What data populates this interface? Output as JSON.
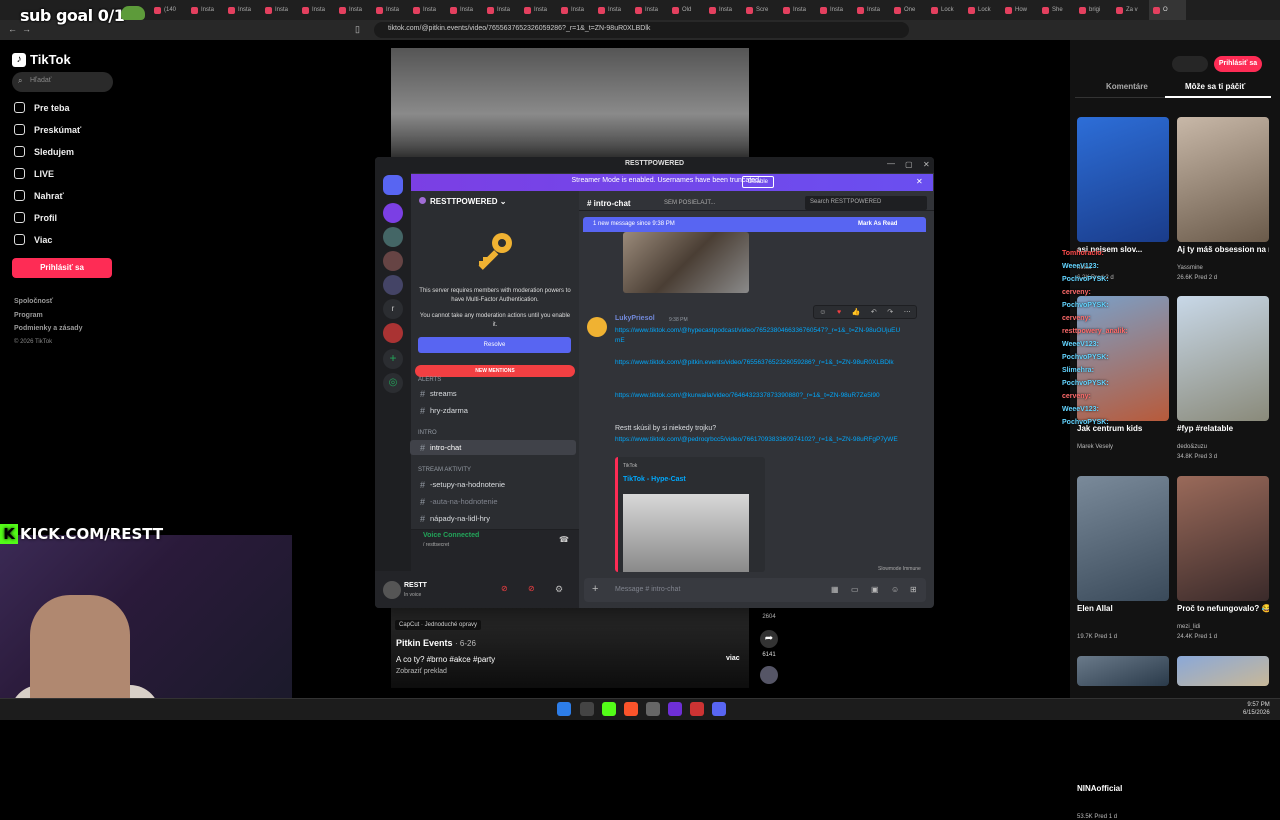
{
  "overlay": {
    "subgoal": "sub goal 0/1",
    "kick": "KICK.COM/RESTT"
  },
  "browser": {
    "tabs": [
      "(140",
      "Insta",
      "Insta",
      "Insta",
      "Insta",
      "Insta",
      "Insta",
      "Insta",
      "Insta",
      "Insta",
      "Insta",
      "Insta",
      "Insta",
      "Insta",
      "Old",
      "Insta",
      "Scre",
      "Insta",
      "Insta",
      "Insta",
      "One",
      "Lock",
      "Lock",
      "How",
      "She",
      "brigi",
      "Za v",
      "O"
    ],
    "url": "tiktok.com/@pitkin.events/video/7655637652326059286?_r=1&_t=ZN-98uR0XLBDlk"
  },
  "tiktok": {
    "logo": "TikTok",
    "search_placeholder": "Hľadať",
    "nav": [
      "Pre teba",
      "Preskúmať",
      "Sledujem",
      "LIVE",
      "Nahrať",
      "Profil",
      "Viac"
    ],
    "login": "Prihlásiť sa",
    "footer": [
      "Spoločnosť",
      "Program",
      "Podmienky a zásady"
    ],
    "copyright": "© 2026 TikTok",
    "video": {
      "capcut": "CapCut · Jednoduché opravy",
      "author": "Pitkin Events",
      "date": "· 6-26",
      "caption": "A co ty? #brno #akce #party",
      "translate": "Zobraziť preklad",
      "more": "viac",
      "likes": "2604",
      "shares": "6141"
    },
    "right": {
      "login": "Prihlásiť sa",
      "tabs": [
        "Komentáre",
        "Môže sa ti páčiť"
      ],
      "videos": [
        {
          "title": "asi nejsem slov...",
          "author": "helca",
          "views": "6.2K",
          "age": "Pred 2 d"
        },
        {
          "title": "Aj ty máš obsession na ružovú? 💖 Tak...",
          "author": "Yassmine",
          "views": "26.6K",
          "age": "Pred 2 d"
        },
        {
          "title": "Jak centrum kids",
          "author": "Marek Vesely",
          "views": "",
          "age": ""
        },
        {
          "title": "#fyp #relatable",
          "author": "dedo&zuzu",
          "views": "34.8K",
          "age": "Pred 3 d"
        },
        {
          "title": "Elen Allal",
          "author": "",
          "views": "19.7K",
          "age": "Pred 1 d"
        },
        {
          "title": "Proč to nefungovalo? 😂 #fyp...",
          "author": "mezi_lidi",
          "views": "24.4K",
          "age": "Pred 1 d"
        },
        {
          "title": "NINAofficial",
          "author": "",
          "views": "53.5K",
          "age": "Pred 1 d"
        }
      ]
    }
  },
  "chat": [
    "Tomhoracio:",
    "WeeeV123:",
    "PochvoPYSK:",
    "cerveny:",
    "PochvoPYSK:",
    "cerveny:",
    "resttpowery_analik:",
    "WeeeV123:",
    "PochvoPYSK:",
    "Slimehra:",
    "PochvoPYSK:",
    "cerveny:",
    "WeeeV123:",
    "PochvoPYSK:"
  ],
  "discord": {
    "title": "RESTTPOWERED",
    "streamer_mode": "Streamer Mode is enabled. Usernames have been truncated.",
    "disable": "Disable",
    "server": "RESTTPOWERED",
    "mfa1": "This server requires members with moderation powers to have Multi-Factor Authentication.",
    "mfa2": "You cannot take any moderation actions until you enable it.",
    "resolve": "Resolve",
    "new_mentions": "NEW MENTIONS",
    "categories": [
      "ALERTS",
      "INTRO",
      "STREAM AKTIVITY"
    ],
    "channels": [
      "streams",
      "hry-zdarma",
      "intro-chat",
      "-setupy-na-hodnotenie",
      "-auta-na-hodnotenie",
      "nápady-na-lidl-hry"
    ],
    "voice_connected": "Voice Connected",
    "voice_sub": "/ resttsecret",
    "username": "RESTT",
    "userstatus": "In voice",
    "channel": "intro-chat",
    "topic": "SEM POSIELAJT...",
    "search": "Search RESTTPOWERED",
    "new_message": "1 new message since 9:38 PM",
    "mark_read": "Mark As Read",
    "message": {
      "author": "LukyPriesol",
      "time": "9:38 PM",
      "links": [
        "https://www.tiktok.com/@hypecastpodcast/video/7652380466336760547?_r=1&_t=ZN-98uOUjuEUmE",
        "https://www.tiktok.com/@pitkin.events/video/7655637652326059286?_r=1&_t=ZN-98uR0XLBDlk",
        "https://www.tiktok.com/@kurwaila/video/7646432337873390880?_r=1&_t=ZN-98uR7Ze5l90"
      ],
      "question": "Restt skúsil by si niekedy trojku?",
      "link4": "https://www.tiktok.com/@pedroqrbcc5/video/7661709383360974102?_r=1&_t=ZN-98uRFgP7yWE",
      "embed_provider": "TikTok",
      "embed_title": "TikTok - Hype-Cast"
    },
    "slowmode": "Slowmode Immune",
    "input_placeholder": "Message #",
    "input_channel": "intro-chat"
  },
  "taskbar": {
    "time": "9:57 PM",
    "date": "6/15/2026"
  }
}
